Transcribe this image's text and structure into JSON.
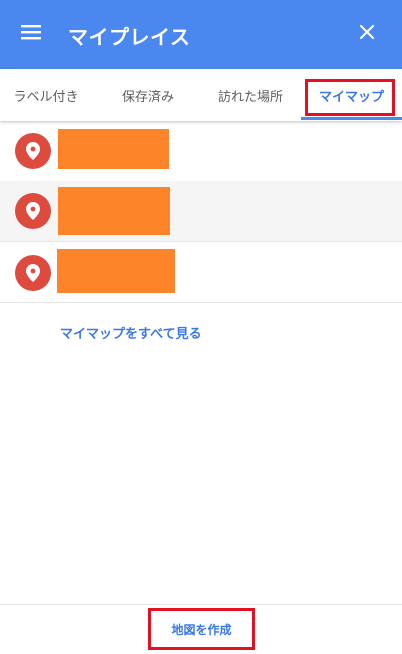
{
  "header": {
    "title": "マイプレイス",
    "menu_icon": "hamburger-menu-icon",
    "close_icon": "close-icon",
    "background": "#4a87ef"
  },
  "tabs": [
    {
      "label": "ラベル付き",
      "active": false
    },
    {
      "label": "保存済み",
      "active": false
    },
    {
      "label": "訪れた場所",
      "active": false
    },
    {
      "label": "マイマップ",
      "active": true
    }
  ],
  "maps": [
    {
      "icon": "map-pin-icon",
      "name_redacted": true
    },
    {
      "icon": "map-pin-icon",
      "name_redacted": true
    },
    {
      "icon": "map-pin-icon",
      "name_redacted": true
    }
  ],
  "see_all_label": "マイマップをすべて見る",
  "footer": {
    "create_map_label": "地図を作成"
  },
  "colors": {
    "accent": "#3b78e7",
    "pin": "#dc4b3e",
    "redaction": "#fd8428",
    "highlight_box": "#e5101f"
  }
}
